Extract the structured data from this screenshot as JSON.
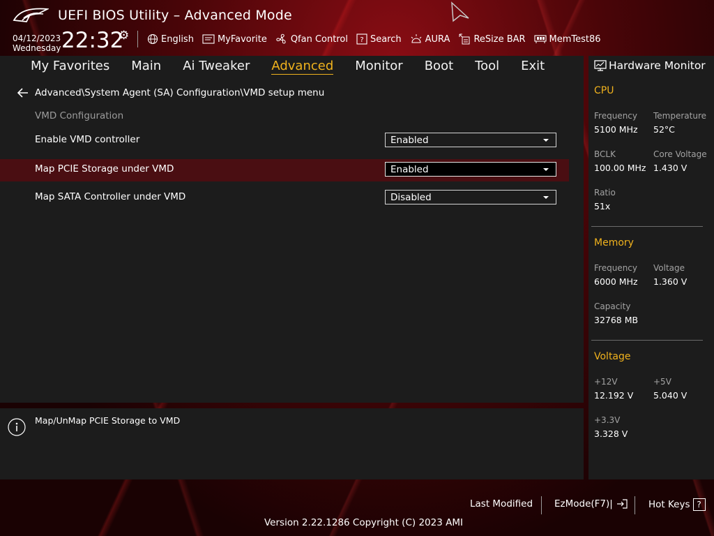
{
  "header": {
    "title": "UEFI BIOS Utility – Advanced Mode",
    "date": "04/12/2023",
    "weekday": "Wednesday",
    "time": "22:32",
    "settings_icon": "gear-icon",
    "toolbar": [
      {
        "label": "English",
        "icon": "globe-icon"
      },
      {
        "label": "MyFavorite",
        "icon": "favorite-icon"
      },
      {
        "label": "Qfan Control",
        "icon": "fan-icon"
      },
      {
        "label": "Search",
        "icon": "question-box-icon"
      },
      {
        "label": "AURA",
        "icon": "aura-icon"
      },
      {
        "label": "ReSize BAR",
        "icon": "resize-bar-icon"
      },
      {
        "label": "MemTest86",
        "icon": "memory-icon"
      }
    ]
  },
  "nav": {
    "tabs": [
      "My Favorites",
      "Main",
      "Ai Tweaker",
      "Advanced",
      "Monitor",
      "Boot",
      "Tool",
      "Exit"
    ],
    "active": "Advanced"
  },
  "content": {
    "path": "Advanced\\System Agent (SA) Configuration\\VMD setup menu",
    "section_title": "VMD Configuration",
    "settings": [
      {
        "label": "Enable VMD controller",
        "value": "Enabled"
      },
      {
        "label": "Map PCIE Storage under VMD",
        "value": "Enabled"
      },
      {
        "label": "Map SATA Controller under VMD",
        "value": "Disabled"
      }
    ],
    "selected_index": 1
  },
  "help": {
    "text": "Map/UnMap PCIE Storage to VMD"
  },
  "hardware_monitor": {
    "title": "Hardware Monitor",
    "cpu": {
      "title": "CPU",
      "frequency_label": "Frequency",
      "frequency": "5100 MHz",
      "temperature_label": "Temperature",
      "temperature": "52°C",
      "bclk_label": "BCLK",
      "bclk": "100.00 MHz",
      "core_voltage_label": "Core Voltage",
      "core_voltage": "1.430 V",
      "ratio_label": "Ratio",
      "ratio": "51x"
    },
    "memory": {
      "title": "Memory",
      "frequency_label": "Frequency",
      "frequency": "6000 MHz",
      "voltage_label": "Voltage",
      "voltage": "1.360 V",
      "capacity_label": "Capacity",
      "capacity": "32768 MB"
    },
    "voltage": {
      "title": "Voltage",
      "v12_label": "+12V",
      "v12": "12.192 V",
      "v5_label": "+5V",
      "v5": "5.040 V",
      "v33_label": "+3.3V",
      "v33": "3.328 V"
    }
  },
  "footer": {
    "last_modified": "Last Modified",
    "ezmode": "EzMode(F7)|",
    "hot_keys": "Hot Keys",
    "hot_keys_key": "?",
    "version": "Version 2.22.1286 Copyright (C) 2023 AMI"
  },
  "colors": {
    "accent": "#f0b21d",
    "highlight_row": "#4a0e12",
    "panel": "#1c1c1c"
  }
}
